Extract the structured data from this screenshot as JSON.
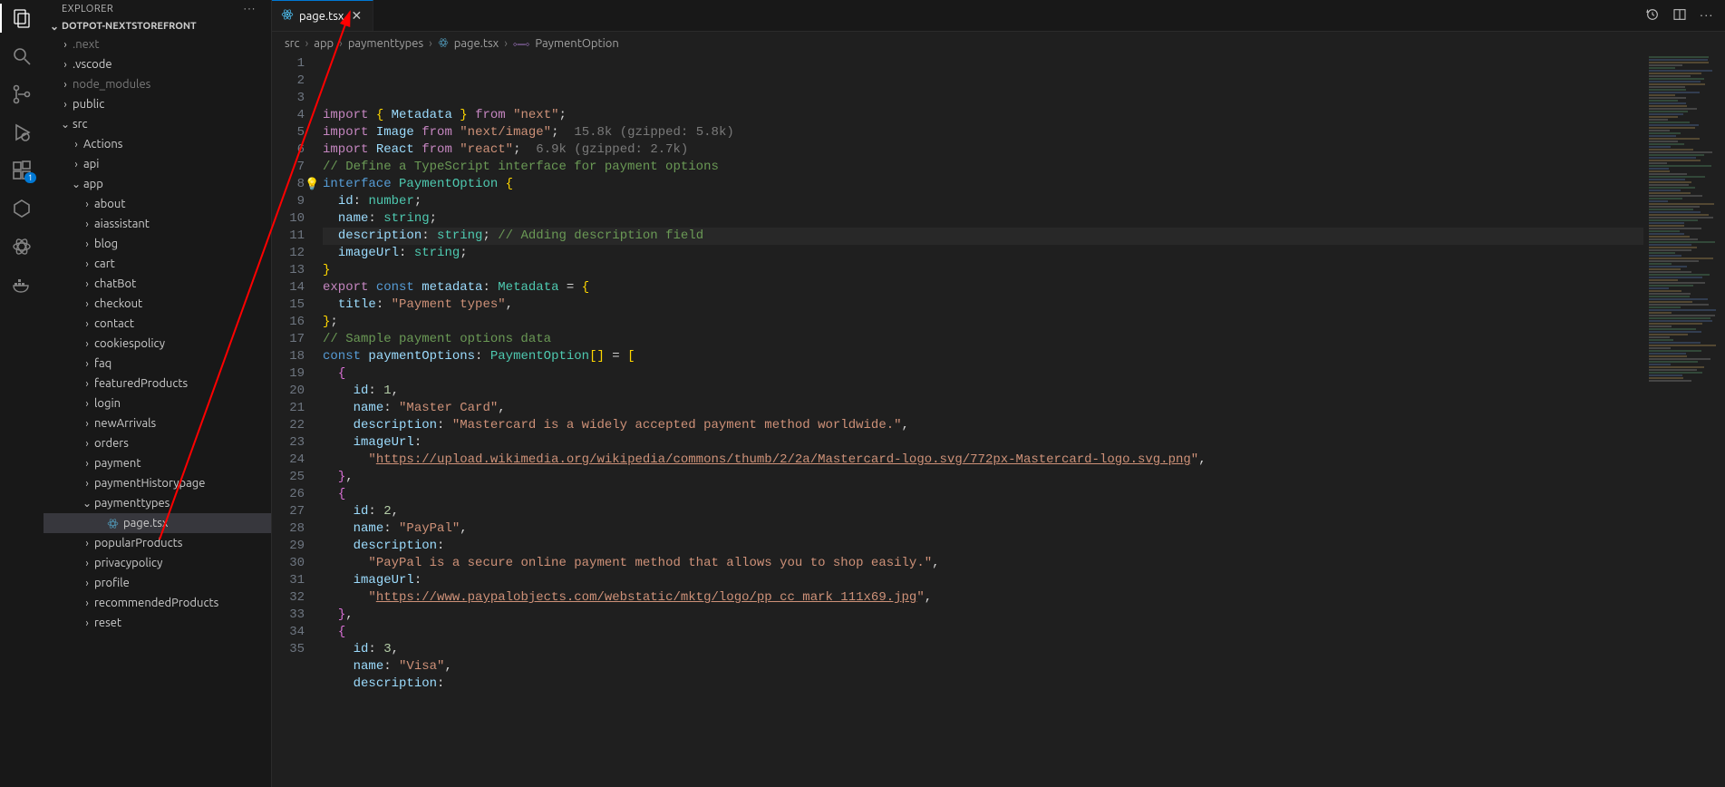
{
  "explorer": {
    "title": "EXPLORER",
    "project": "DOTPOT-NEXTSTOREFRONT"
  },
  "tree": {
    "items": [
      {
        "label": ".next",
        "indent": 1,
        "chev": "›",
        "dim": true
      },
      {
        "label": ".vscode",
        "indent": 1,
        "chev": "›",
        "dim": false
      },
      {
        "label": "node_modules",
        "indent": 1,
        "chev": "›",
        "dim": true
      },
      {
        "label": "public",
        "indent": 1,
        "chev": "›",
        "dim": false
      },
      {
        "label": "src",
        "indent": 1,
        "chev": "⌄",
        "dim": false
      },
      {
        "label": "Actions",
        "indent": 2,
        "chev": "›",
        "dim": false
      },
      {
        "label": "api",
        "indent": 2,
        "chev": "›",
        "dim": false
      },
      {
        "label": "app",
        "indent": 2,
        "chev": "⌄",
        "dim": false
      },
      {
        "label": "about",
        "indent": 3,
        "chev": "›",
        "dim": false
      },
      {
        "label": "aiassistant",
        "indent": 3,
        "chev": "›",
        "dim": false
      },
      {
        "label": "blog",
        "indent": 3,
        "chev": "›",
        "dim": false
      },
      {
        "label": "cart",
        "indent": 3,
        "chev": "›",
        "dim": false
      },
      {
        "label": "chatBot",
        "indent": 3,
        "chev": "›",
        "dim": false
      },
      {
        "label": "checkout",
        "indent": 3,
        "chev": "›",
        "dim": false
      },
      {
        "label": "contact",
        "indent": 3,
        "chev": "›",
        "dim": false
      },
      {
        "label": "cookiespolicy",
        "indent": 3,
        "chev": "›",
        "dim": false
      },
      {
        "label": "faq",
        "indent": 3,
        "chev": "›",
        "dim": false
      },
      {
        "label": "featuredProducts",
        "indent": 3,
        "chev": "›",
        "dim": false
      },
      {
        "label": "login",
        "indent": 3,
        "chev": "›",
        "dim": false
      },
      {
        "label": "newArrivals",
        "indent": 3,
        "chev": "›",
        "dim": false
      },
      {
        "label": "orders",
        "indent": 3,
        "chev": "›",
        "dim": false
      },
      {
        "label": "payment",
        "indent": 3,
        "chev": "›",
        "dim": false
      },
      {
        "label": "paymentHistorypage",
        "indent": 3,
        "chev": "›",
        "dim": false
      },
      {
        "label": "paymenttypes",
        "indent": 3,
        "chev": "⌄",
        "dim": false
      },
      {
        "label": "page.tsx",
        "indent": 4,
        "chev": "",
        "dim": false,
        "file": true,
        "selected": true
      },
      {
        "label": "popularProducts",
        "indent": 3,
        "chev": "›",
        "dim": false
      },
      {
        "label": "privacypolicy",
        "indent": 3,
        "chev": "›",
        "dim": false
      },
      {
        "label": "profile",
        "indent": 3,
        "chev": "›",
        "dim": false
      },
      {
        "label": "recommendedProducts",
        "indent": 3,
        "chev": "›",
        "dim": false
      },
      {
        "label": "reset",
        "indent": 3,
        "chev": "›",
        "dim": false
      }
    ]
  },
  "tab": {
    "label": "page.tsx"
  },
  "breadcrumb": {
    "parts": [
      "src",
      "app",
      "paymenttypes",
      "page.tsx",
      "PaymentOption"
    ]
  },
  "ext_badge": "1",
  "code": {
    "lines": [
      "import { Metadata } from \"next\";",
      "import Image from \"next/image\";  15.8k (gzipped: 5.8k)",
      "import React from \"react\";  6.9k (gzipped: 2.7k)",
      "",
      "// Define a TypeScript interface for payment options",
      "interface PaymentOption {",
      "  id: number;",
      "  name: string;",
      "  description: string; // Adding description field",
      "  imageUrl: string;",
      "}",
      "export const metadata: Metadata = {",
      "  title: \"Payment types\",",
      "};",
      "// Sample payment options data",
      "const paymentOptions: PaymentOption[] = [",
      "  {",
      "    id: 1,",
      "    name: \"Master Card\",",
      "    description: \"Mastercard is a widely accepted payment method worldwide.\",",
      "    imageUrl:",
      "      \"https://upload.wikimedia.org/wikipedia/commons/thumb/2/2a/Mastercard-logo.svg/772px-Mastercard-logo.svg.png\",",
      "  },",
      "  {",
      "    id: 2,",
      "    name: \"PayPal\",",
      "    description:",
      "      \"PayPal is a secure online payment method that allows you to shop easily.\",",
      "    imageUrl:",
      "      \"https://www.paypalobjects.com/webstatic/mktg/logo/pp_cc_mark_111x69.jpg\",",
      "  },",
      "  {",
      "    id: 3,",
      "    name: \"Visa\",",
      "    description:"
    ]
  }
}
